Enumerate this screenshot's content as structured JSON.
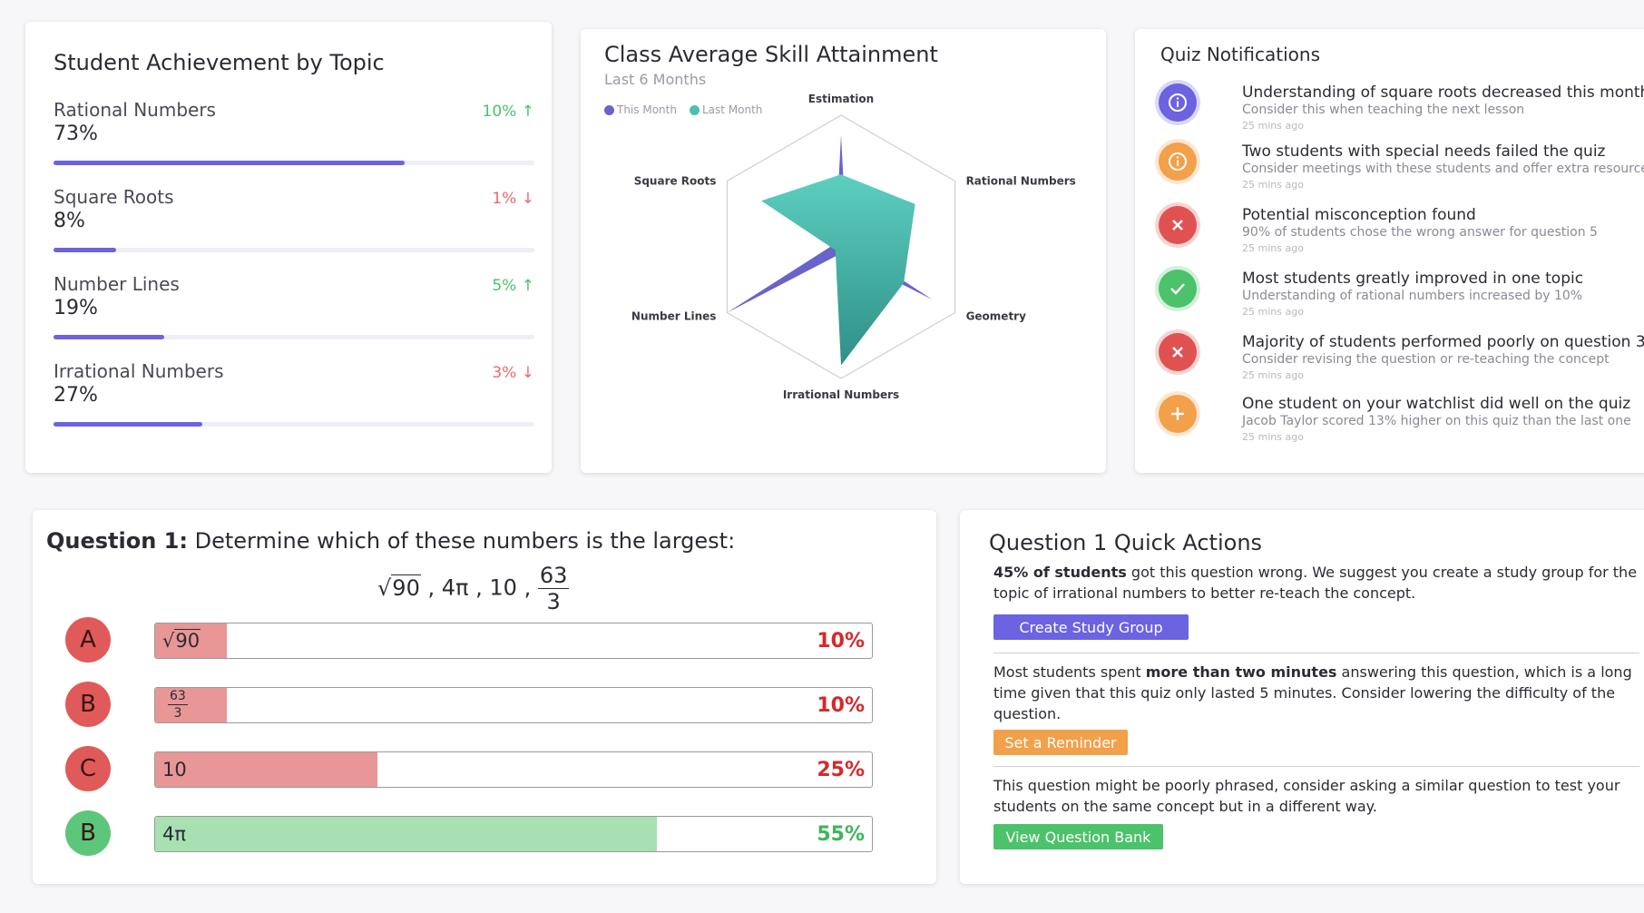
{
  "achievement": {
    "title": "Student Achievement by Topic",
    "topics": [
      {
        "name": "Rational Numbers",
        "percent": "73%",
        "change": "10%",
        "direction": "up",
        "level": 0.73
      },
      {
        "name": "Square Roots",
        "percent": "8%",
        "change": "1%",
        "direction": "down",
        "level": 0.13
      },
      {
        "name": "Number Lines",
        "percent": "19%",
        "change": "5%",
        "direction": "up",
        "level": 0.23
      },
      {
        "name": "Irrational Numbers",
        "percent": "27%",
        "change": "3%",
        "direction": "down",
        "level": 0.31
      }
    ],
    "colors": {
      "bar": "#6c63e0",
      "up": "#4cc26a",
      "down": "#ea6a6a"
    }
  },
  "radar": {
    "title": "Class Average Skill Attainment",
    "subtitle": "Last 6 Months",
    "legend": [
      {
        "label": "This Month",
        "color": "#6a63c9"
      },
      {
        "label": "Last Month",
        "color": "#4cbfb0"
      }
    ],
    "axes": [
      "Estimation",
      "Rational Numbers",
      "Geometry",
      "Irrational Numbers",
      "Number Lines",
      "Square Roots"
    ]
  },
  "chart_data": {
    "type": "radar",
    "axes": [
      "Estimation",
      "Rational Numbers",
      "Geometry",
      "Irrational Numbers",
      "Number Lines",
      "Square Roots"
    ],
    "series": [
      {
        "name": "This Month",
        "values": [
          0.85,
          0.05,
          0.8,
          0.05,
          1.0,
          0.05
        ]
      },
      {
        "name": "Last Month",
        "values": [
          0.55,
          0.65,
          0.55,
          0.9,
          0.05,
          0.7
        ]
      }
    ],
    "range": [
      0,
      1
    ]
  },
  "notifications": {
    "title": "Quiz Notifications",
    "items": [
      {
        "icon": "info-icon",
        "color": "#6c63e0",
        "title": "Understanding of square roots decreased this month",
        "desc": "Consider this when teaching the next lesson",
        "time": "25 mins ago"
      },
      {
        "icon": "info-icon",
        "color": "#f2a04a",
        "title": "Two students with special needs failed the quiz",
        "desc": "Consider meetings with these students and offer extra resources",
        "time": "25 mins ago"
      },
      {
        "icon": "close-icon",
        "color": "#e05252",
        "title": "Potential misconception found",
        "desc": "90% of students chose the wrong answer for question 5",
        "time": "25 mins ago"
      },
      {
        "icon": "check-icon",
        "color": "#4cc26a",
        "title": "Most students greatly improved in one topic",
        "desc": "Understanding of rational numbers increased by 10%",
        "time": "25 mins ago"
      },
      {
        "icon": "close-icon",
        "color": "#e05252",
        "title": "Majority of students performed poorly on question 3",
        "desc": "Consider revising the question or re-teaching the concept",
        "time": "25 mins ago"
      },
      {
        "icon": "plus-icon",
        "color": "#f2a04a",
        "title": "One student on your watchlist did well on the quiz",
        "desc": "Jacob Taylor scored 13% higher on this quiz than the last one",
        "time": "25 mins ago"
      }
    ]
  },
  "question": {
    "label": "Question 1:",
    "text": "Determine which of these numbers is the largest:",
    "expr": {
      "sqrt_radicand": "90",
      "pi_term": "4π",
      "ten": "10",
      "frac_num": "63",
      "frac_den": "3",
      "sep": ","
    },
    "options": [
      {
        "letter": "A",
        "answer_type": "sqrt",
        "answer": "90",
        "percent": "10%",
        "fill": 0.1,
        "correct": false
      },
      {
        "letter": "B",
        "answer_type": "frac",
        "answer_num": "63",
        "answer_den": "3",
        "percent": "10%",
        "fill": 0.1,
        "correct": false
      },
      {
        "letter": "C",
        "answer_type": "text",
        "answer": "10",
        "percent": "25%",
        "fill": 0.31,
        "correct": false
      },
      {
        "letter": "B",
        "answer_type": "text",
        "answer": "4π",
        "percent": "55%",
        "fill": 0.7,
        "correct": true
      }
    ],
    "colors": {
      "wrong_badge": "#e05a5a",
      "wrong_fill": "#e89696",
      "wrong_text": "#d42a2a",
      "right_badge": "#5cc77a",
      "right_fill": "#a8e0b2",
      "right_text": "#3fb55c"
    }
  },
  "quick_actions": {
    "title": "Question 1 Quick Actions",
    "p1_bold": "45% of students",
    "p1_rest": " got this question wrong. We suggest you create a study group for the topic of irrational numbers to better re-teach the concept.",
    "btn1": "Create Study Group",
    "p2_start": "Most students spent ",
    "p2_bold": "more than two minutes",
    "p2_rest": " answering this question, which is a long time given that this quiz only lasted 5 minutes. Consider lowering the difficulty of the question.",
    "btn2": "Set a Reminder",
    "p3": "This question might be poorly phrased, consider asking a similar question to test your students on the same concept but in a different way.",
    "btn3": "View Question Bank",
    "colors": {
      "btn1": "#6c63e0",
      "btn2": "#f2a04a",
      "btn3": "#4cc26a"
    }
  }
}
